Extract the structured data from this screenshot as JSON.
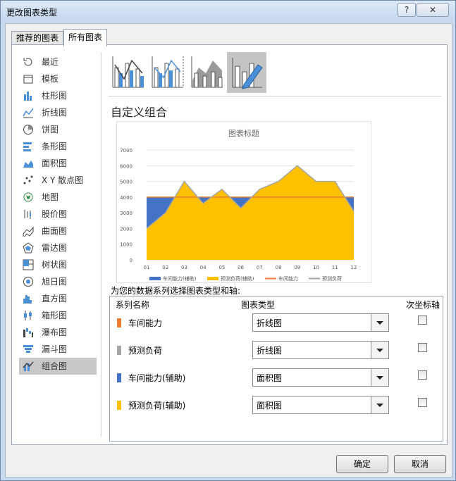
{
  "window": {
    "title": "更改图表类型",
    "help": "?",
    "close": "✕"
  },
  "tabs": [
    {
      "label": "推荐的图表"
    },
    {
      "label": "所有图表"
    }
  ],
  "sidebar": {
    "items": [
      {
        "label": "最近",
        "icon": "recent-icon"
      },
      {
        "label": "模板",
        "icon": "template-icon"
      },
      {
        "label": "柱形图",
        "icon": "column-chart-icon"
      },
      {
        "label": "折线图",
        "icon": "line-chart-icon"
      },
      {
        "label": "饼图",
        "icon": "pie-chart-icon"
      },
      {
        "label": "条形图",
        "icon": "bar-chart-icon"
      },
      {
        "label": "面积图",
        "icon": "area-chart-icon"
      },
      {
        "label": "X Y 散点图",
        "icon": "scatter-chart-icon"
      },
      {
        "label": "地图",
        "icon": "map-chart-icon"
      },
      {
        "label": "股价图",
        "icon": "stock-chart-icon"
      },
      {
        "label": "曲面图",
        "icon": "surface-chart-icon"
      },
      {
        "label": "雷达图",
        "icon": "radar-chart-icon"
      },
      {
        "label": "树状图",
        "icon": "treemap-chart-icon"
      },
      {
        "label": "旭日图",
        "icon": "sunburst-chart-icon"
      },
      {
        "label": "直方图",
        "icon": "histogram-chart-icon"
      },
      {
        "label": "箱形图",
        "icon": "box-whisker-chart-icon"
      },
      {
        "label": "瀑布图",
        "icon": "waterfall-chart-icon"
      },
      {
        "label": "漏斗图",
        "icon": "funnel-chart-icon"
      },
      {
        "label": "组合图",
        "icon": "combo-chart-icon"
      }
    ],
    "selected": "组合图"
  },
  "main": {
    "heading": "自定义组合",
    "series_prompt": "为您的数据系列选择图表类型和轴:",
    "table_headers": {
      "name": "系列名称",
      "type": "图表类型",
      "secondary": "次坐标轴"
    },
    "series_rows": [
      {
        "name": "车间能力",
        "color": "#ed7d31",
        "type": "折线图",
        "secondary": false
      },
      {
        "name": "预测负荷",
        "color": "#a5a5a5",
        "type": "折线图",
        "secondary": false
      },
      {
        "name": "车间能力(辅助)",
        "color": "#4472c4",
        "type": "面积图",
        "secondary": false
      },
      {
        "name": "预测负荷(辅助)",
        "color": "#ffc000",
        "type": "面积图",
        "secondary": false
      }
    ]
  },
  "buttons": {
    "ok": "确定",
    "cancel": "取消"
  },
  "chart_data": {
    "type": "area",
    "title": "图表标题",
    "categories": [
      "01",
      "02",
      "03",
      "04",
      "05",
      "06",
      "07",
      "08",
      "09",
      "10",
      "11",
      "12"
    ],
    "ylim": [
      0,
      7000
    ],
    "yticks": [
      0,
      1000,
      2000,
      3000,
      4000,
      5000,
      6000,
      7000
    ],
    "grid": true,
    "legend_position": "bottom",
    "series": [
      {
        "name": "车间能力(辅助)",
        "kind": "area",
        "color": "#4472c4",
        "values": [
          4000,
          4000,
          4000,
          4000,
          4000,
          4000,
          4000,
          4000,
          4000,
          4000,
          4000,
          4000
        ]
      },
      {
        "name": "预测负荷(辅助)",
        "kind": "area",
        "color": "#ffc000",
        "values": [
          2000,
          3000,
          5000,
          3600,
          4500,
          3300,
          4500,
          5000,
          6000,
          5000,
          5000,
          3100
        ]
      },
      {
        "name": "车间能力",
        "kind": "line",
        "color": "#ed7d31",
        "values": [
          4000,
          4000,
          4000,
          4000,
          4000,
          4000,
          4000,
          4000,
          4000,
          4000,
          4000,
          4000
        ]
      },
      {
        "name": "预测负荷",
        "kind": "line",
        "color": "#a5a5a5",
        "values": [
          2000,
          3000,
          5000,
          3600,
          4500,
          3300,
          4500,
          5000,
          6000,
          5000,
          5000,
          3100
        ]
      }
    ]
  }
}
